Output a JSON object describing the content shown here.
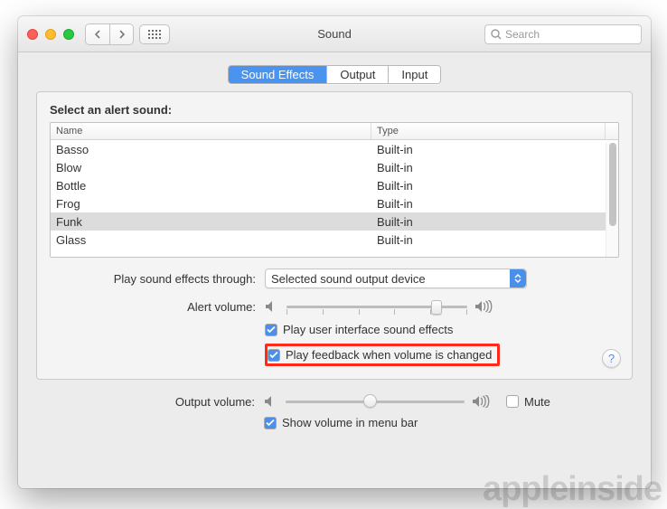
{
  "window": {
    "title": "Sound",
    "search_placeholder": "Search"
  },
  "tabs": {
    "effects": "Sound Effects",
    "output": "Output",
    "input": "Input",
    "active": "effects"
  },
  "alert_section": {
    "heading": "Select an alert sound:",
    "columns": {
      "name": "Name",
      "type": "Type"
    },
    "rows": [
      {
        "name": "Basso",
        "type": "Built-in",
        "selected": false
      },
      {
        "name": "Blow",
        "type": "Built-in",
        "selected": false
      },
      {
        "name": "Bottle",
        "type": "Built-in",
        "selected": false
      },
      {
        "name": "Frog",
        "type": "Built-in",
        "selected": false
      },
      {
        "name": "Funk",
        "type": "Built-in",
        "selected": true
      },
      {
        "name": "Glass",
        "type": "Built-in",
        "selected": false
      }
    ]
  },
  "play_through": {
    "label": "Play sound effects through:",
    "value": "Selected sound output device"
  },
  "alert_volume": {
    "label": "Alert volume:",
    "percent": 85
  },
  "checkboxes": {
    "ui_sounds": {
      "label": "Play user interface sound effects",
      "checked": true
    },
    "volume_feedback": {
      "label": "Play feedback when volume is changed",
      "checked": true,
      "highlighted": true
    }
  },
  "output_volume": {
    "label": "Output volume:",
    "percent": 47,
    "mute_label": "Mute",
    "mute_checked": false
  },
  "menu_bar": {
    "label": "Show volume in menu bar",
    "checked": true
  },
  "help": "?",
  "watermark": "appleinside"
}
